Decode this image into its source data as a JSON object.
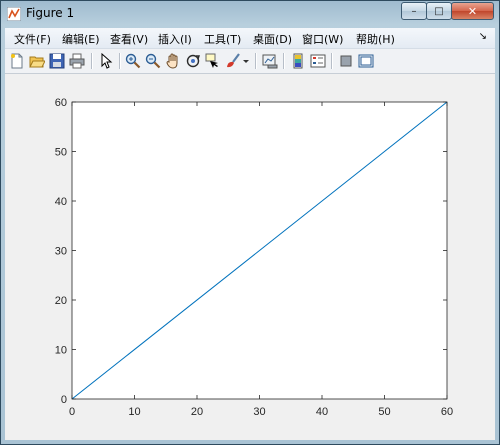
{
  "window": {
    "title": "Figure 1",
    "caption_buttons": {
      "minimize": "–",
      "maximize": "□",
      "close": "✕"
    }
  },
  "menubar": {
    "items": [
      {
        "label": "文件(F)"
      },
      {
        "label": "编辑(E)"
      },
      {
        "label": "查看(V)"
      },
      {
        "label": "插入(I)"
      },
      {
        "label": "工具(T)"
      },
      {
        "label": "桌面(D)"
      },
      {
        "label": "窗口(W)"
      },
      {
        "label": "帮助(H)"
      }
    ],
    "overflow": "↘"
  },
  "toolbar": {
    "icons": [
      "new-figure-icon",
      "open-file-icon",
      "save-icon",
      "print-icon",
      "pointer-icon",
      "zoom-in-icon",
      "zoom-out-icon",
      "pan-hand-icon",
      "rotate-3d-icon",
      "data-cursor-icon",
      "brush-icon",
      "link-plot-icon",
      "colorbar-icon",
      "legend-icon",
      "hide-plot-tools-icon",
      "show-plot-tools-icon"
    ]
  },
  "colors": {
    "line": "#0072bd",
    "axes_bg": "#ffffff",
    "figure_bg": "#f0f0f0"
  },
  "chart_data": {
    "type": "line",
    "x": [
      0,
      60
    ],
    "y": [
      0,
      60
    ],
    "xlim": [
      0,
      60
    ],
    "ylim": [
      0,
      60
    ],
    "xticks": [
      0,
      10,
      20,
      30,
      40,
      50,
      60
    ],
    "yticks": [
      0,
      10,
      20,
      30,
      40,
      50,
      60
    ],
    "grid": false,
    "title": "",
    "xlabel": "",
    "ylabel": ""
  }
}
